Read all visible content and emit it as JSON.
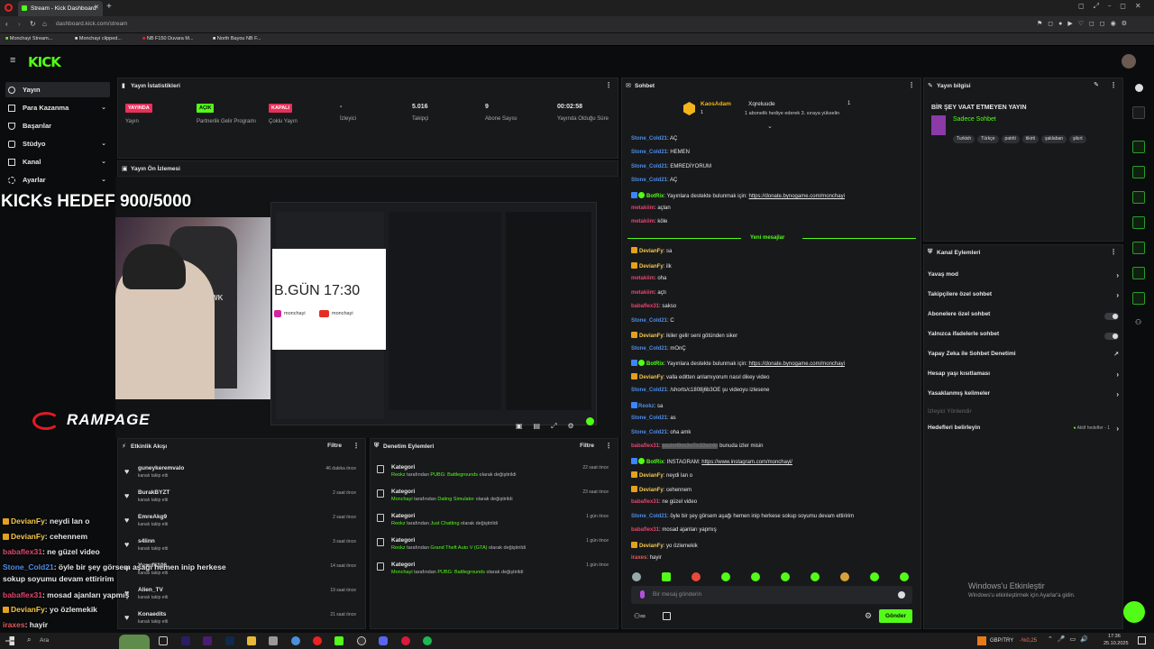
{
  "browser": {
    "tab_title": "Stream - Kick Dashboard",
    "url": "dashboard.kick.com/stream",
    "bookmarks": [
      "Monchayi Stream...",
      "Monchayi clipped...",
      "NB F150 Duvara M...",
      "North Bayou NB F..."
    ]
  },
  "kick": {
    "logo": "KICK"
  },
  "sidebar": {
    "items": [
      {
        "label": "Yayın"
      },
      {
        "label": "Para Kazanma"
      },
      {
        "label": "Başarılar"
      },
      {
        "label": "Stüdyo"
      },
      {
        "label": "Kanal"
      },
      {
        "label": "Ayarlar"
      }
    ]
  },
  "stats": {
    "title": "Yayın İstatistikleri",
    "items": [
      {
        "badge": "YAYINDA",
        "label": "Yayın"
      },
      {
        "badge": "AÇIK",
        "label": "Partnerlik Gelir Programı"
      },
      {
        "badge": "KAPALI",
        "label": "Çoklu Yayın"
      },
      {
        "value": "-",
        "label": "İzleyici"
      },
      {
        "value": "5.016",
        "label": "Takipçi"
      },
      {
        "value": "9",
        "label": "Abone Sayısı"
      },
      {
        "value": "00:02:58",
        "label": "Yayında Olduğu Süre"
      }
    ]
  },
  "preview": {
    "title": "Yayın Ön İzlemesi",
    "overlay_title": "KICKs HEDEF 900/5000",
    "brand": "RAMPAGE",
    "headset_brand": "HAWK",
    "banner_text": "B.GÜN 17:30",
    "social1": "monchayi",
    "social2": "monchayi"
  },
  "activity": {
    "title": "Etkinlik Akışı",
    "filter": "Filtre",
    "items": [
      {
        "name": "guneykeremvalo",
        "sub": "kanalı takip etti",
        "time": "46 dakika önce"
      },
      {
        "name": "BurakBYZT",
        "sub": "kanalı takip etti",
        "time": "2 saat önce"
      },
      {
        "name": "EmreAkg9",
        "sub": "kanalı takip etti",
        "time": "2 saat önce"
      },
      {
        "name": "s4linn",
        "sub": "kanalı takip etti",
        "time": "3 saat önce"
      },
      {
        "name": "Yusuf6106",
        "sub": "kanalı takip etti",
        "time": "14 saat önce"
      },
      {
        "name": "Alien_TV",
        "sub": "kanalı takip etti",
        "time": "19 saat önce"
      },
      {
        "name": "Konaedits",
        "sub": "kanalı takip etti",
        "time": "21 saat önce"
      }
    ]
  },
  "moderation": {
    "title": "Denetim Eylemleri",
    "filter": "Filtre",
    "items": [
      {
        "name": "Kategori",
        "who": "Reokz",
        "mid": " tarafından ",
        "game": "PUBG: Battlegrounds",
        "end": " olarak değiştirildi",
        "time": "22 saat önce"
      },
      {
        "name": "Kategori",
        "who": "Monchayi",
        "mid": " tarafından ",
        "game": "Dating Simulator",
        "end": " olarak değiştirildi",
        "time": "23 saat önce"
      },
      {
        "name": "Kategori",
        "who": "Reokz",
        "mid": " tarafından ",
        "game": "Just Chatting",
        "end": " olarak değiştirildi",
        "time": "1 gün önce"
      },
      {
        "name": "Kategori",
        "who": "Reokz",
        "mid": " tarafından ",
        "game": "Grand Theft Auto V (GTA)",
        "end": " olarak değiştirildi",
        "time": "1 gün önce"
      },
      {
        "name": "Kategori",
        "who": "Monchayi",
        "mid": " tarafından ",
        "game": "PUBG: Battlegrounds",
        "end": " olarak değiştirildi",
        "time": "1 gün önce"
      }
    ]
  },
  "chat": {
    "title": "Sohbet",
    "pinned_user": "KaosAdam",
    "pinned_count": "1",
    "pinned_target": "Xqreluude",
    "pinned_text": "1 abonelik hediye ederek 3. sıraya yükselin",
    "pinned_right": "1",
    "new_messages": "Yeni mesajlar",
    "placeholder": "Bir mesaj gönderin",
    "send": "Gönder",
    "messages": [
      {
        "user": "Stone_Cold21",
        "color": "blue",
        "text": ": AÇ"
      },
      {
        "user": "Stone_Cold21",
        "color": "blue",
        "text": ": HEMEN"
      },
      {
        "user": "Stone_Cold21",
        "color": "blue",
        "text": ": EMREDİYORUM"
      },
      {
        "user": "Stone_Cold21",
        "color": "blue",
        "text": ": AÇ"
      },
      {
        "user": "BotRix",
        "color": "grn",
        "text": ": Yayınlara destekte bulunmak için: ",
        "link": "https://donate.bynogame.com/monchayi"
      },
      {
        "user": "metakiim",
        "color": "red",
        "text": ": açlan"
      },
      {
        "user": "metakiim",
        "color": "red",
        "text": ": köle"
      },
      {
        "user": "DevianFy",
        "color": "yel",
        "text": ": sa"
      },
      {
        "user": "DevianFy",
        "color": "yel",
        "text": ": ilk"
      },
      {
        "user": "metakiim",
        "color": "red",
        "text": ": oha"
      },
      {
        "user": "metakiim",
        "color": "red",
        "text": ": açtı"
      },
      {
        "user": "babaflex31",
        "color": "red",
        "text": ": sakso"
      },
      {
        "user": "Stone_Cold21",
        "color": "blue",
        "text": ": C"
      },
      {
        "user": "DevianFy",
        "color": "yel",
        "text": ": ikiler gelir seni götünden siker"
      },
      {
        "user": "Stone_Cold21",
        "color": "blue",
        "text": ": mOnÇ"
      },
      {
        "user": "BotRix",
        "color": "grn",
        "text": ": Yayınlara destekte bulunmak için: ",
        "link": "https://donate.bynogame.com/monchayi"
      },
      {
        "user": "DevianFy",
        "color": "yel",
        "text": ": valla editten anlamıyorum nasıl dikey video"
      },
      {
        "user": "Stone_Cold21",
        "color": "blue",
        "text": ": /shorts/c1808j6b3OE şu videoyu izlesene"
      },
      {
        "user": "Reokz",
        "color": "blue",
        "text": ": sa"
      },
      {
        "user": "Stone_Cold21",
        "color": "blue",
        "text": ": as"
      },
      {
        "user": "Stone_Cold21",
        "color": "blue",
        "text": ": oha amk"
      },
      {
        "user": "babaflex31",
        "color": "red",
        "text": ": ",
        "spoiler": "aoshxf9vs3n7lc32wz4n",
        "after": " bunuda izler misin"
      },
      {
        "user": "BotRix",
        "color": "grn",
        "text": ": INSTAGRAM: ",
        "link": "https://www.instagram.com/monchayi/"
      },
      {
        "user": "DevianFy",
        "color": "yel",
        "text": ": neydi lan o"
      },
      {
        "user": "DevianFy",
        "color": "yel",
        "text": ": cehennem"
      },
      {
        "user": "babaflex31",
        "color": "red",
        "text": ": ne güzel video"
      },
      {
        "user": "Stone_Cold21",
        "color": "blue",
        "text": ": öyle bir şey görsem aşağı hemen inip herkese sokup soyumu devam ettiririm"
      },
      {
        "user": "babaflex31",
        "color": "red",
        "text": ": mosad ajanları yapmış"
      },
      {
        "user": "DevianFy",
        "color": "yel",
        "text": ": yo özlemekik"
      },
      {
        "user": "iraxes",
        "color": "red2",
        "text": ": hayir"
      }
    ]
  },
  "stream_info": {
    "title": "Yayın bilgisi",
    "stream_title": "BİR ŞEY VAAT ETMEYEN YAYIN",
    "category": "Sadece Sohbet",
    "tags": [
      "Turkish",
      "Türkçe",
      "patriti",
      "tikirti",
      "şaklaban",
      "şikırt"
    ]
  },
  "channel_actions": {
    "title": "Kanal Eylemleri",
    "items": [
      {
        "label": "Yavaş mod",
        "kind": "arrow"
      },
      {
        "label": "Takipçilere özel sohbet",
        "kind": "arrow"
      },
      {
        "label": "Abonelere özel sohbet",
        "kind": "toggle"
      },
      {
        "label": "Yalnızca ifadelerle sohbet",
        "kind": "toggle"
      },
      {
        "label": "Yapay Zeka ile Sohbet Denetimi",
        "kind": "ext"
      },
      {
        "label": "Hesap yaşı kısıtlaması",
        "kind": "arrow"
      },
      {
        "label": "Yasaklanmış kelimeler",
        "kind": "arrow"
      },
      {
        "label": "İzleyici Yönlendir",
        "kind": "disabled"
      },
      {
        "label": "Hedefleri belirleyin",
        "kind": "goal",
        "extra": "Aktif hedefler - 1"
      }
    ]
  },
  "overlay_chat": [
    {
      "user": "DevianFy",
      "color": "yel",
      "text": ": neydi lan o"
    },
    {
      "user": "DevianFy",
      "color": "yel",
      "text": ": cehennem"
    },
    {
      "user": "babaflex31",
      "color": "red",
      "text": ": ne güzel video"
    },
    {
      "user": "Stone_Cold21",
      "color": "blue",
      "text": ": öyle bir şey görsem aşağı hemen inip herkese"
    },
    {
      "user": "",
      "color": "blue",
      "text": "sokup soyumu devam ettiririm"
    },
    {
      "user": "babaflex31",
      "color": "red",
      "text": ": mosad ajanları yapmış"
    },
    {
      "user": "DevianFy",
      "color": "yel",
      "text": ": yo özlemekik"
    },
    {
      "user": "iraxes",
      "color": "red2",
      "text": ": hayir"
    }
  ],
  "windows": {
    "activate_title": "Windows'u Etkinleştir",
    "activate_sub": "Windows'u etkinleştirmek için Ayarlar'a gidin."
  },
  "taskbar": {
    "search": "Ara",
    "currency": "GBP/TRY",
    "change": "-%0,25",
    "time": "17:36",
    "date": "25.10.2025"
  }
}
